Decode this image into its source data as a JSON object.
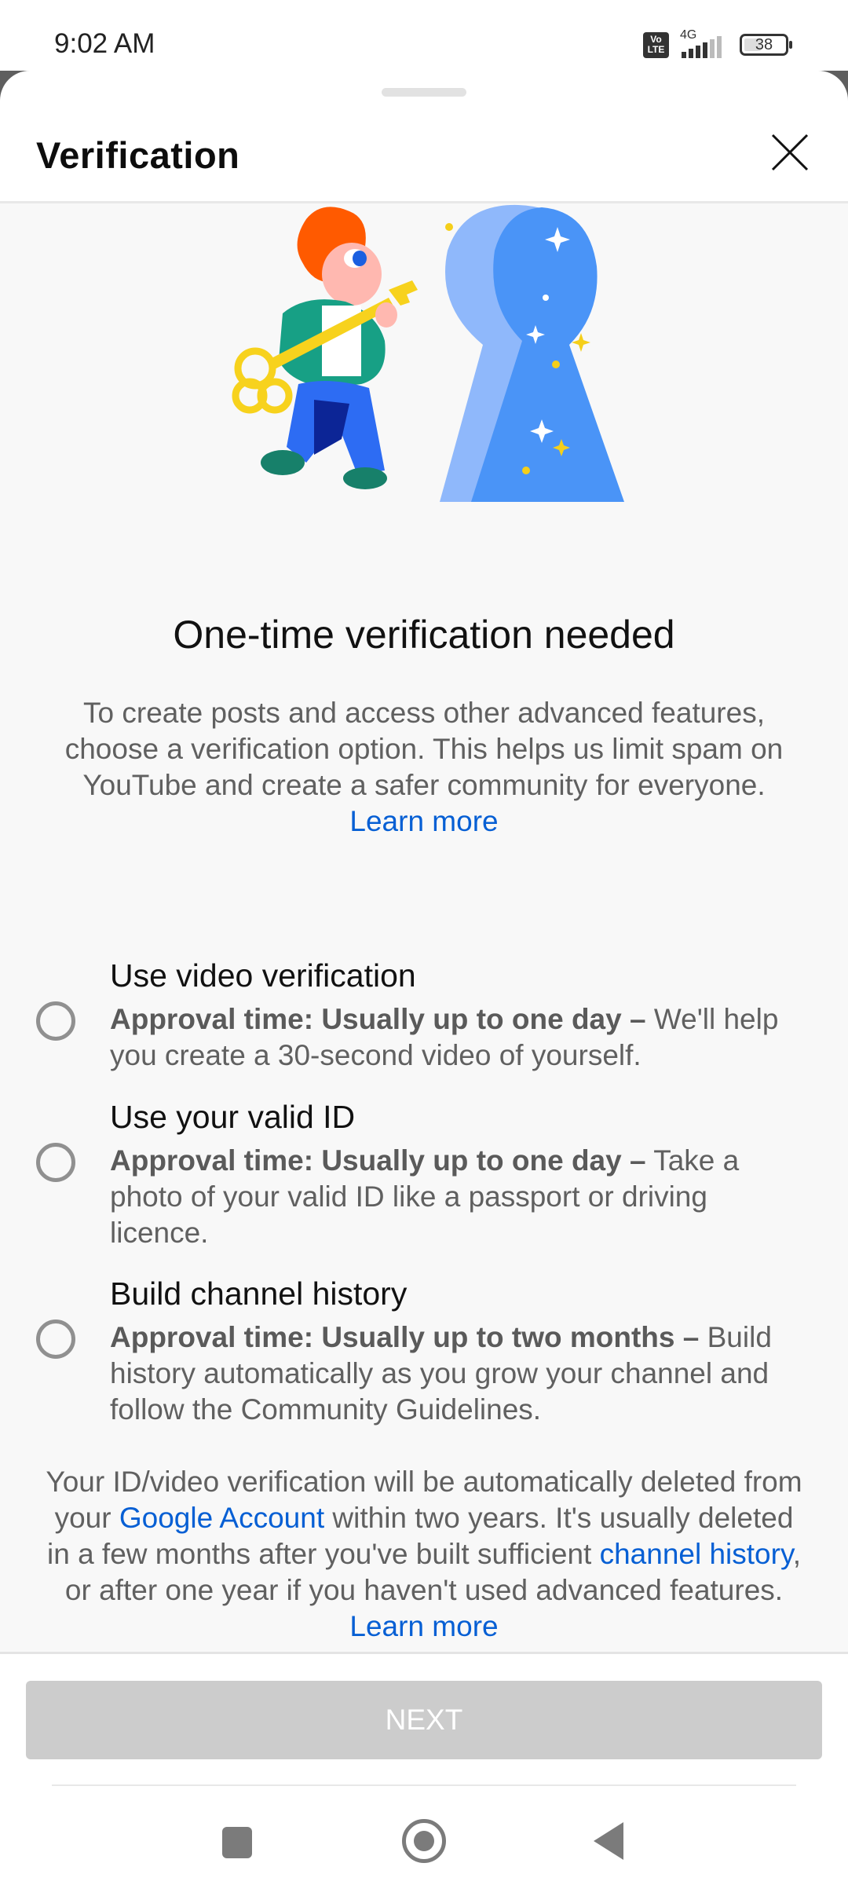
{
  "status_bar": {
    "time": "9:02 AM",
    "volte": "Vo LTE",
    "network": "4G",
    "battery_level": "38"
  },
  "sheet": {
    "title": "Verification",
    "close_icon": "close-icon"
  },
  "main": {
    "heading": "One-time verification needed",
    "intro_text": "To create posts and access other advanced features, choose a verification option. This helps us limit spam on YouTube and create a safer community for everyone.",
    "intro_link": "Learn more",
    "options": [
      {
        "title": "Use video verification",
        "approval": "Approval time: Usually up to one day –",
        "description": "We'll help you create a 30-second video of yourself.",
        "selected": false
      },
      {
        "title": "Use your valid ID",
        "approval": "Approval time: Usually up to one day –",
        "description": "Take a photo of your valid ID like a passport or driving licence.",
        "selected": false
      },
      {
        "title": "Build channel history",
        "approval": "Approval time: Usually up to two months –",
        "description": "Build history automatically as you grow your channel and follow the Community Guidelines.",
        "selected": false
      }
    ],
    "footer": {
      "text_1": "Your ID/video verification will be automatically deleted from your",
      "link_google_account": "Google Account",
      "text_2": "within two years. It's usually deleted in a few months after you've built sufficient",
      "link_channel_history": "channel history",
      "text_3": ", or after one year if you haven't used advanced features.",
      "learn_more": "Learn more"
    }
  },
  "bottom": {
    "next_label": "NEXT",
    "next_enabled": false
  },
  "colors": {
    "link": "#065fd4",
    "disabled_button": "#cccccc",
    "radio_border": "#909090"
  }
}
